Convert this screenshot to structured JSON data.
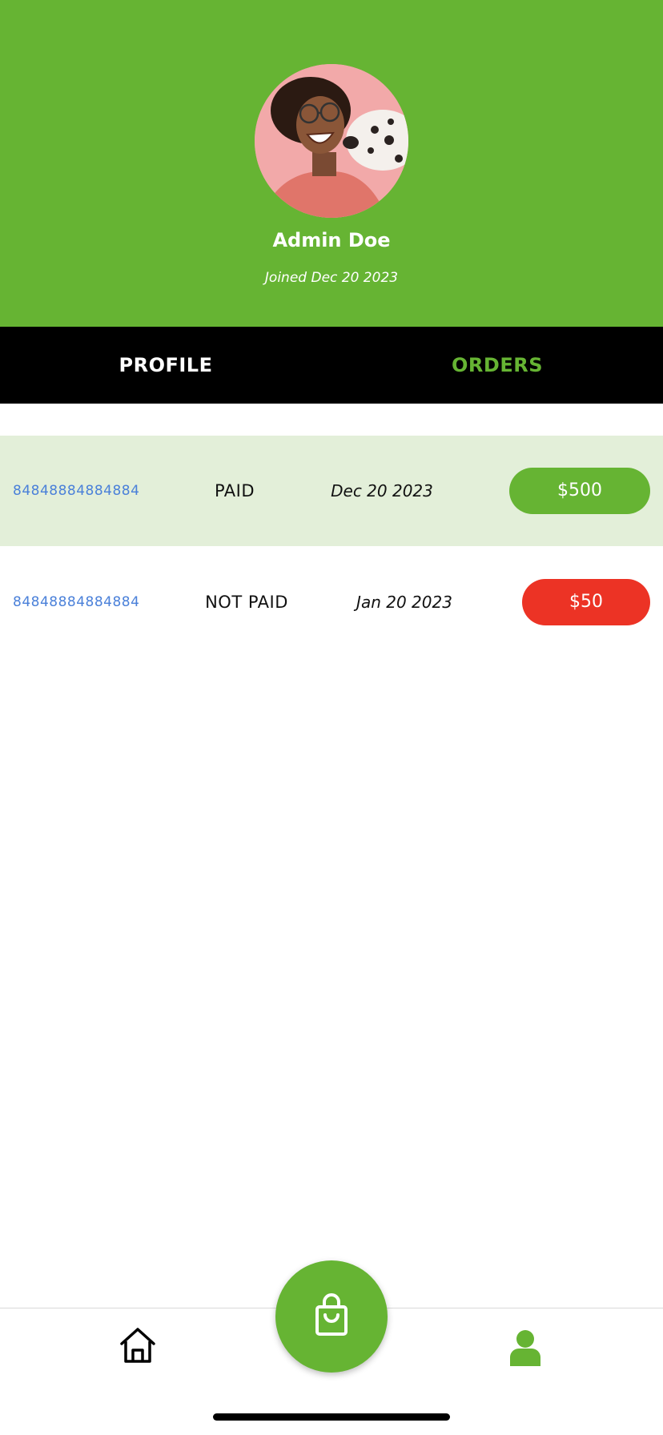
{
  "profile": {
    "name": "Admin Doe",
    "joined": "Joined Dec 20 2023"
  },
  "tabs": [
    {
      "label": "PROFILE",
      "active": false
    },
    {
      "label": "ORDERS",
      "active": true
    }
  ],
  "orders": [
    {
      "id": "84848884884884",
      "status": "PAID",
      "date": "Dec 20 2023",
      "amount": "$500",
      "amount_color": "#66b433",
      "highlighted": true
    },
    {
      "id": "84848884884884",
      "status": "NOT PAID",
      "date": "Jan 20 2023",
      "amount": "$50",
      "amount_color": "#ec3325",
      "highlighted": false
    }
  ],
  "bottom_nav": {
    "items": [
      {
        "icon": "home-icon",
        "active": false
      },
      {
        "icon": "shopping-bag-icon",
        "active": false
      },
      {
        "icon": "user-icon",
        "active": true
      }
    ]
  },
  "colors": {
    "brand_green": "#66b433",
    "alert_red": "#ec3325",
    "link_blue": "#4a80d9",
    "row_highlight": "#e3efd9"
  }
}
